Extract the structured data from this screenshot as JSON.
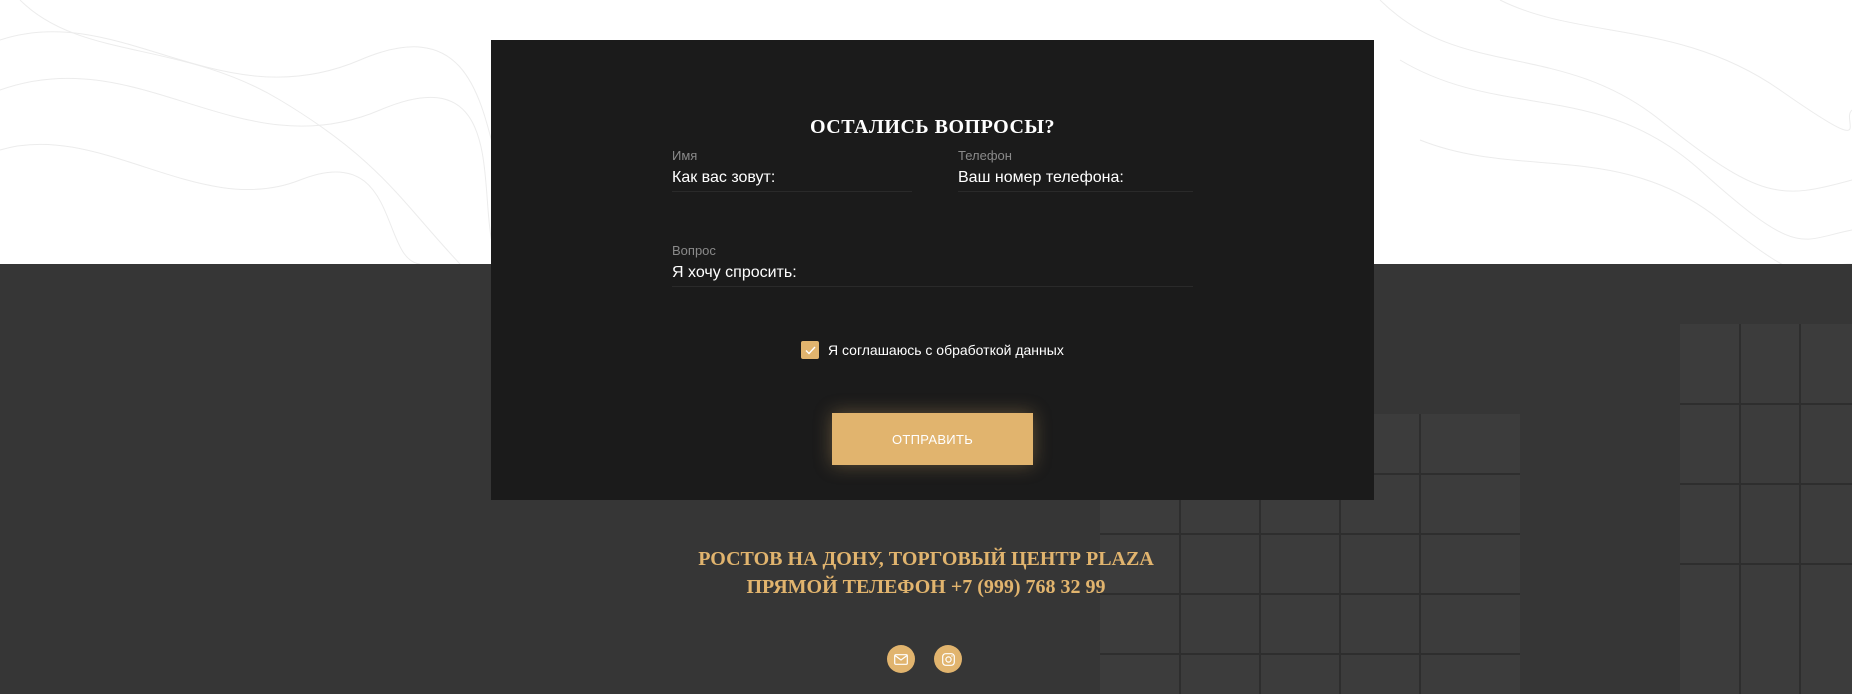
{
  "form": {
    "title": "ОСТАЛИСЬ ВОПРОСЫ?",
    "name": {
      "label": "Имя",
      "placeholder": "Как вас зовут:",
      "value": ""
    },
    "phone": {
      "label": "Телефон",
      "placeholder": "Ваш номер телефона:",
      "value": ""
    },
    "question": {
      "label": "Вопрос",
      "placeholder": "Я хочу спросить:",
      "value": ""
    },
    "consent": {
      "label": "Я соглашаюсь с обработкой данных",
      "checked": true
    },
    "submit_label": "ОТПРАВИТЬ"
  },
  "contact": {
    "address": "РОСТОВ НА ДОНУ, ТОРГОВЫЙ ЦЕНТР PLAZA",
    "phone_line": "ПРЯМОЙ ТЕЛЕФОН +7 (999) 768 32 99"
  },
  "social": [
    {
      "icon": "mail-icon"
    },
    {
      "icon": "instagram-icon"
    }
  ],
  "colors": {
    "accent": "#e1b46e",
    "card_background": "#1b1b1b",
    "footer_background": "#363636",
    "top_background": "#ffffff"
  }
}
